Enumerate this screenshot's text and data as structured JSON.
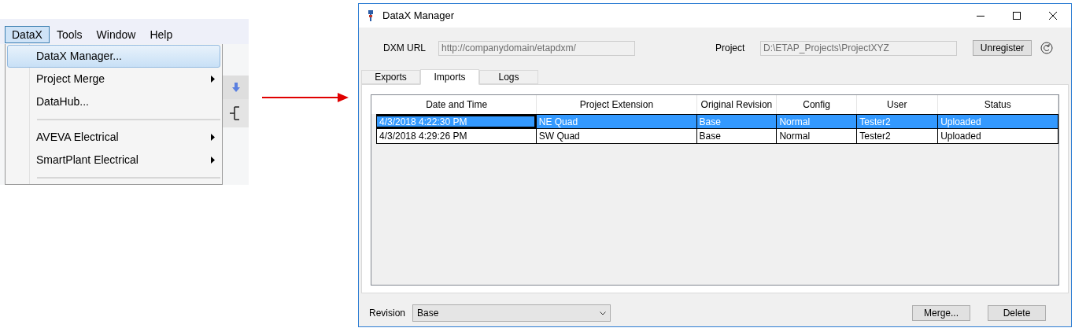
{
  "menu_bar": [
    {
      "label": "DataX",
      "selected": true
    },
    {
      "label": "Tools",
      "selected": false
    },
    {
      "label": "Window",
      "selected": false
    },
    {
      "label": "Help",
      "selected": false
    }
  ],
  "menu": [
    {
      "kind": "item",
      "label": "DataX Manager...",
      "selected": true,
      "submenu": false
    },
    {
      "kind": "item",
      "label": "Project Merge",
      "selected": false,
      "submenu": true
    },
    {
      "kind": "item",
      "label": "DataHub...",
      "selected": false,
      "submenu": false
    },
    {
      "kind": "separator"
    },
    {
      "kind": "item",
      "label": "AVEVA Electrical",
      "selected": false,
      "submenu": true
    },
    {
      "kind": "item",
      "label": "SmartPlant Electrical",
      "selected": false,
      "submenu": true
    },
    {
      "kind": "separator"
    }
  ],
  "window": {
    "title": "DataX Manager"
  },
  "dxm_url": {
    "label": "DXM URL",
    "value": "http://companydomain/etapdxm/"
  },
  "project": {
    "label": "Project",
    "value": "D:\\ETAP_Projects\\ProjectXYZ"
  },
  "unregister_button": "Unregister",
  "tabs": [
    {
      "label": "Exports",
      "selected": false
    },
    {
      "label": "Imports",
      "selected": true
    },
    {
      "label": "Logs",
      "selected": false
    }
  ],
  "table": {
    "columns": [
      "Date and Time",
      "Project Extension",
      "Original Revision",
      "Config",
      "User",
      "Status"
    ],
    "rows": [
      {
        "cells": [
          "4/3/2018 4:22:30 PM",
          "NE Quad",
          "Base",
          "Normal",
          "Tester2",
          "Uploaded"
        ],
        "selected": true
      },
      {
        "cells": [
          "4/3/2018 4:29:26 PM",
          "SW Quad",
          "Base",
          "Normal",
          "Tester2",
          "Uploaded"
        ],
        "selected": false
      }
    ]
  },
  "revision": {
    "label": "Revision",
    "value": "Base"
  },
  "buttons": [
    "Merge...",
    "Delete"
  ]
}
